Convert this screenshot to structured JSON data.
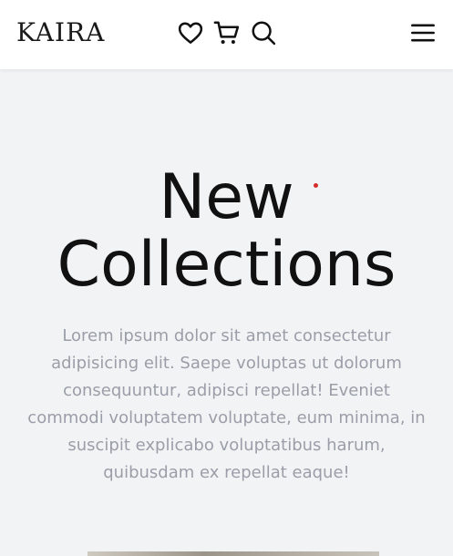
{
  "header": {
    "logo": "KAIRA",
    "icons": [
      "heart-icon",
      "cart-icon",
      "search-icon",
      "menu-icon"
    ]
  },
  "hero": {
    "title_line1": "New",
    "title_line2": "Collections",
    "description": "Lorem ipsum dolor sit amet consectetur adipisicing elit. Saepe voluptas ut dolorum consequuntur, adipisci repellat! Eveniet commodi voluptatem voluptate, eum minima, in suscipit explicabo voluptatibus harum, quibusdam ex repellat eaque!"
  },
  "colors": {
    "background": "#f2f3f5",
    "header_bg": "#ffffff",
    "title": "#111111",
    "description": "#9a9ea8",
    "accent_dot": "#d62c2c"
  }
}
